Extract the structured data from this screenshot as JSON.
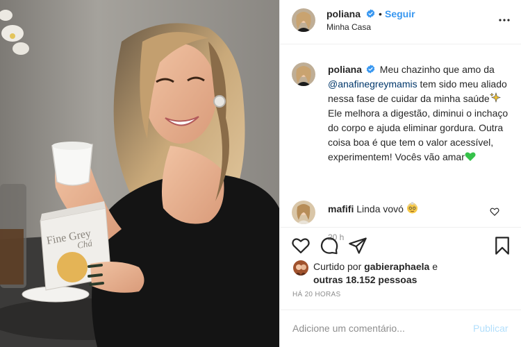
{
  "post_header": {
    "username": "poliana",
    "separator": "•",
    "follow_label": "Seguir",
    "location": "Minha Casa"
  },
  "caption": {
    "username": "poliana",
    "text_part1": "Meu chazinho que amo da",
    "mention": "@anafinegreymamis",
    "text_part2": "tem sido meu aliado nessa fase de cuidar da minha saúde",
    "text_part3": "Ele melhora a digestão, diminui o inchaço do corpo e ajuda eliminar gordura. Outra coisa boa é que tem o valor acessível, experimentem! Vocês vão amar",
    "time": "20 h"
  },
  "comment": {
    "username": "mafifi",
    "text": "Linda vovó"
  },
  "likes": {
    "prefix": "Curtido por",
    "first_liker": "gabieraphaela",
    "conjunction": "e",
    "others": "outras 18.152 pessoas"
  },
  "timestamp": "HÁ 20 HORAS",
  "comment_box": {
    "placeholder": "Adicione um comentário...",
    "publish_label": "Publicar"
  },
  "photo": {
    "box_label_line1": "Fine Grey",
    "box_label_line2": "Chá"
  },
  "colors": {
    "link_blue": "#3897f0",
    "mention_blue": "#00376b",
    "publish_disabled": "#b2dffc",
    "verified_blue": "#3897f0",
    "muted_gray": "#8e8e8e"
  },
  "icons": [
    "more-options-icon",
    "verified-badge-icon",
    "heart-icon",
    "comment-icon",
    "share-icon",
    "bookmark-icon",
    "sparkles-emoji",
    "green-heart-emoji",
    "grandma-emoji"
  ]
}
